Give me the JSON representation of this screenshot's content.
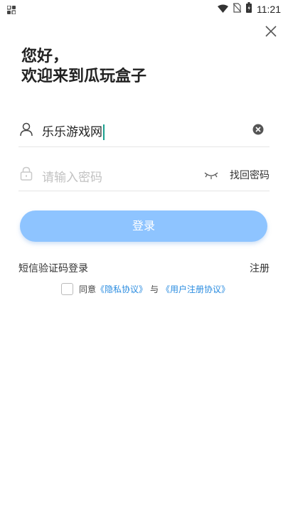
{
  "status_bar": {
    "time": "11:21"
  },
  "greeting": {
    "line1": "您好，",
    "line2": "欢迎来到瓜玩盒子"
  },
  "username_field": {
    "value": "乐乐游戏网"
  },
  "password_field": {
    "placeholder": "请输入密码",
    "find_password": "找回密码"
  },
  "login_button": {
    "label": "登录"
  },
  "sms_login": "短信验证码登录",
  "register": "注册",
  "agreement": {
    "prefix": "同意",
    "privacy_link": "《隐私协议》",
    "connector": "与",
    "user_link": "《用户注册协议》"
  },
  "colors": {
    "accent": "#8ec4ff",
    "link": "#2a8ce0",
    "caret": "#1aa08f"
  },
  "icons": [
    "app-icon",
    "wifi-icon",
    "no-sim-icon",
    "battery-icon",
    "close-icon",
    "user-icon",
    "clear-icon",
    "lock-icon",
    "eye-closed-icon"
  ]
}
